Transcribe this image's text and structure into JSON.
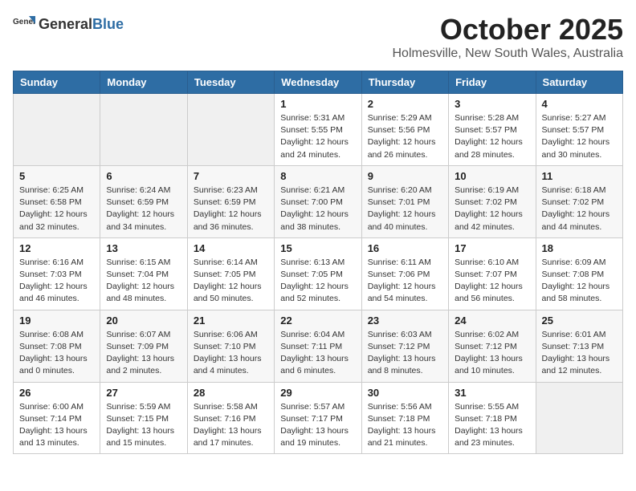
{
  "header": {
    "logo_general": "General",
    "logo_blue": "Blue",
    "month": "October 2025",
    "location": "Holmesville, New South Wales, Australia"
  },
  "weekdays": [
    "Sunday",
    "Monday",
    "Tuesday",
    "Wednesday",
    "Thursday",
    "Friday",
    "Saturday"
  ],
  "weeks": [
    [
      {
        "day": "",
        "info": ""
      },
      {
        "day": "",
        "info": ""
      },
      {
        "day": "",
        "info": ""
      },
      {
        "day": "1",
        "info": "Sunrise: 5:31 AM\nSunset: 5:55 PM\nDaylight: 12 hours\nand 24 minutes."
      },
      {
        "day": "2",
        "info": "Sunrise: 5:29 AM\nSunset: 5:56 PM\nDaylight: 12 hours\nand 26 minutes."
      },
      {
        "day": "3",
        "info": "Sunrise: 5:28 AM\nSunset: 5:57 PM\nDaylight: 12 hours\nand 28 minutes."
      },
      {
        "day": "4",
        "info": "Sunrise: 5:27 AM\nSunset: 5:57 PM\nDaylight: 12 hours\nand 30 minutes."
      }
    ],
    [
      {
        "day": "5",
        "info": "Sunrise: 6:25 AM\nSunset: 6:58 PM\nDaylight: 12 hours\nand 32 minutes."
      },
      {
        "day": "6",
        "info": "Sunrise: 6:24 AM\nSunset: 6:59 PM\nDaylight: 12 hours\nand 34 minutes."
      },
      {
        "day": "7",
        "info": "Sunrise: 6:23 AM\nSunset: 6:59 PM\nDaylight: 12 hours\nand 36 minutes."
      },
      {
        "day": "8",
        "info": "Sunrise: 6:21 AM\nSunset: 7:00 PM\nDaylight: 12 hours\nand 38 minutes."
      },
      {
        "day": "9",
        "info": "Sunrise: 6:20 AM\nSunset: 7:01 PM\nDaylight: 12 hours\nand 40 minutes."
      },
      {
        "day": "10",
        "info": "Sunrise: 6:19 AM\nSunset: 7:02 PM\nDaylight: 12 hours\nand 42 minutes."
      },
      {
        "day": "11",
        "info": "Sunrise: 6:18 AM\nSunset: 7:02 PM\nDaylight: 12 hours\nand 44 minutes."
      }
    ],
    [
      {
        "day": "12",
        "info": "Sunrise: 6:16 AM\nSunset: 7:03 PM\nDaylight: 12 hours\nand 46 minutes."
      },
      {
        "day": "13",
        "info": "Sunrise: 6:15 AM\nSunset: 7:04 PM\nDaylight: 12 hours\nand 48 minutes."
      },
      {
        "day": "14",
        "info": "Sunrise: 6:14 AM\nSunset: 7:05 PM\nDaylight: 12 hours\nand 50 minutes."
      },
      {
        "day": "15",
        "info": "Sunrise: 6:13 AM\nSunset: 7:05 PM\nDaylight: 12 hours\nand 52 minutes."
      },
      {
        "day": "16",
        "info": "Sunrise: 6:11 AM\nSunset: 7:06 PM\nDaylight: 12 hours\nand 54 minutes."
      },
      {
        "day": "17",
        "info": "Sunrise: 6:10 AM\nSunset: 7:07 PM\nDaylight: 12 hours\nand 56 minutes."
      },
      {
        "day": "18",
        "info": "Sunrise: 6:09 AM\nSunset: 7:08 PM\nDaylight: 12 hours\nand 58 minutes."
      }
    ],
    [
      {
        "day": "19",
        "info": "Sunrise: 6:08 AM\nSunset: 7:08 PM\nDaylight: 13 hours\nand 0 minutes."
      },
      {
        "day": "20",
        "info": "Sunrise: 6:07 AM\nSunset: 7:09 PM\nDaylight: 13 hours\nand 2 minutes."
      },
      {
        "day": "21",
        "info": "Sunrise: 6:06 AM\nSunset: 7:10 PM\nDaylight: 13 hours\nand 4 minutes."
      },
      {
        "day": "22",
        "info": "Sunrise: 6:04 AM\nSunset: 7:11 PM\nDaylight: 13 hours\nand 6 minutes."
      },
      {
        "day": "23",
        "info": "Sunrise: 6:03 AM\nSunset: 7:12 PM\nDaylight: 13 hours\nand 8 minutes."
      },
      {
        "day": "24",
        "info": "Sunrise: 6:02 AM\nSunset: 7:12 PM\nDaylight: 13 hours\nand 10 minutes."
      },
      {
        "day": "25",
        "info": "Sunrise: 6:01 AM\nSunset: 7:13 PM\nDaylight: 13 hours\nand 12 minutes."
      }
    ],
    [
      {
        "day": "26",
        "info": "Sunrise: 6:00 AM\nSunset: 7:14 PM\nDaylight: 13 hours\nand 13 minutes."
      },
      {
        "day": "27",
        "info": "Sunrise: 5:59 AM\nSunset: 7:15 PM\nDaylight: 13 hours\nand 15 minutes."
      },
      {
        "day": "28",
        "info": "Sunrise: 5:58 AM\nSunset: 7:16 PM\nDaylight: 13 hours\nand 17 minutes."
      },
      {
        "day": "29",
        "info": "Sunrise: 5:57 AM\nSunset: 7:17 PM\nDaylight: 13 hours\nand 19 minutes."
      },
      {
        "day": "30",
        "info": "Sunrise: 5:56 AM\nSunset: 7:18 PM\nDaylight: 13 hours\nand 21 minutes."
      },
      {
        "day": "31",
        "info": "Sunrise: 5:55 AM\nSunset: 7:18 PM\nDaylight: 13 hours\nand 23 minutes."
      },
      {
        "day": "",
        "info": ""
      }
    ]
  ]
}
